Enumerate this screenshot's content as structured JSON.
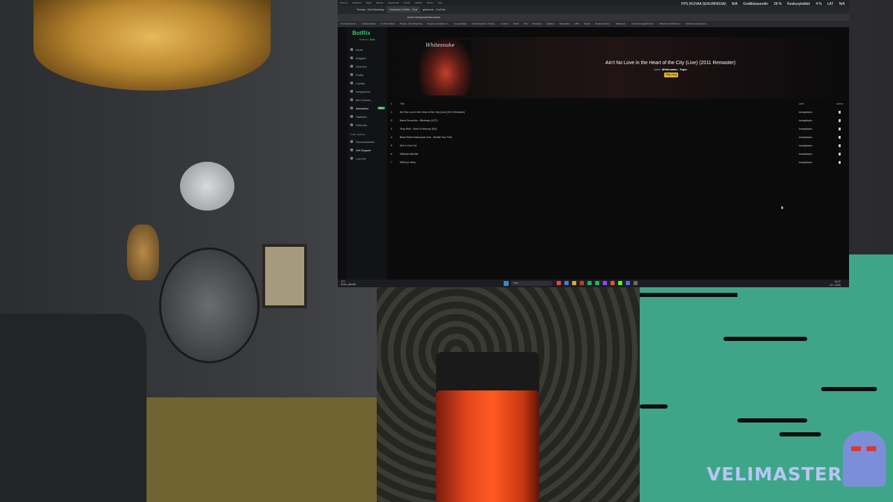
{
  "window": {
    "titlebar_items": [
      "Tiedosto",
      "Muokkaa",
      "Näytä",
      "Historia",
      "Kirjanmerkit",
      "Profiilit",
      "Välilehti",
      "Ikkuna",
      "Ohje"
    ],
    "tabs": [
      {
        "label": "Browse - Kick Streaming",
        "active": false
      },
      {
        "label": "Interactive | BotRix - Chat",
        "active": true
      },
      {
        "label": "gameover - YouTube",
        "active": false
      }
    ],
    "address": "botrix.live/panel/interactive"
  },
  "overlay": {
    "fps_label": "FPS (KUVAA SEKUNNISSA)",
    "fps_value": "N/A",
    "gpu_label": "Grafiikkasuoritin",
    "gpu_value": "28 %",
    "cpu_label": "Keskusyksikkö",
    "cpu_value": "4 %",
    "lat_label": "LAT",
    "lat_value": "N/A"
  },
  "bookmarks": [
    "Tuo kirjanmerkit...",
    "Getting Started",
    "YouTube Music",
    "Browse - Kick Streaming",
    "Support velimaster on...",
    "Google Maps",
    "Uusi Webinaari + Ilmoitu...",
    "Youtube",
    "Twitch",
    "Kick",
    "Rockstore",
    "Nightbot",
    "Streamlabs",
    "OBS",
    "Spotify",
    "Vuodenvaihdos...",
    "Rekisteröi...",
    "Free Pixel English Sub...",
    "Watch the Wild Robot...",
    "Alkuvalot asennuksen..."
  ],
  "sidebar": {
    "brand": "BotRix",
    "platform_label": "Platform:",
    "platform_value": "Kick",
    "items": [
      {
        "label": "Alerts",
        "badge": ""
      },
      {
        "label": "Widgets",
        "badge": ""
      },
      {
        "label": "Chat Bot",
        "badge": ""
      },
      {
        "label": "Profile",
        "badge": ""
      },
      {
        "label": "Loyalty",
        "badge": ""
      },
      {
        "label": "Integrations",
        "badge": ""
      },
      {
        "label": "Mini Games",
        "badge": ""
      },
      {
        "label": "Interactive",
        "badge": "NEW"
      },
      {
        "label": "Statistics",
        "badge": ""
      },
      {
        "label": "Referrals",
        "badge": ""
      }
    ],
    "other_options_title": "Other Options",
    "other_items": [
      {
        "label": "Documentation"
      },
      {
        "label": "Get Support"
      },
      {
        "label": "Log Out"
      }
    ]
  },
  "premium_label": "Go Premium",
  "now_playing": {
    "cover_text": "Whitesnake",
    "title": "Ain't No Love in the Heart of the City (Live) (2011 Remaster)",
    "artist_label": "Artist:",
    "artist": "Whitesnake - Topic",
    "skip_label": "Skip song"
  },
  "queue": {
    "headers": {
      "num": "#",
      "title": "Title",
      "user": "User",
      "action": "Action"
    },
    "rows": [
      {
        "num": "1",
        "title": "Ain't No Love in the Heart of the City (Live) (2011 Remaster)",
        "user": "kamquikpixu",
        "playing": true
      },
      {
        "num": "2",
        "title": "Bandi Genocidio - Blindman (1977)",
        "user": "kamquikpixu",
        "playing": false
      },
      {
        "num": "3",
        "title": "Terry Reid - Seed of Memory (HQ)",
        "user": "kamquikpixu",
        "playing": false
      },
      {
        "num": "4",
        "title": "Black Rebel Motorcycle Club - Shuffle Your Feet",
        "user": "kamquikpixu",
        "playing": false
      },
      {
        "num": "5",
        "title": "Shit in Your Cut",
        "user": "kamquikpixu",
        "playing": false
      },
      {
        "num": "6",
        "title": "Kätköpiri kahvilla",
        "user": "kamquikpixu",
        "playing": false
      },
      {
        "num": "7",
        "title": "MIKKI ja Veiku",
        "user": "kamquikpixu",
        "playing": false
      }
    ]
  },
  "taskbar": {
    "weather": "2°C",
    "weather_desc": "Enim. pilvistä",
    "search": "Hae",
    "time": "16.47",
    "date": "23.1.2026"
  },
  "game": {
    "logo": "VELIMASTER"
  },
  "colors": {
    "brand_green": "#37c46a",
    "skip_yellow": "#e0b325",
    "game_teal": "#3fa589"
  }
}
